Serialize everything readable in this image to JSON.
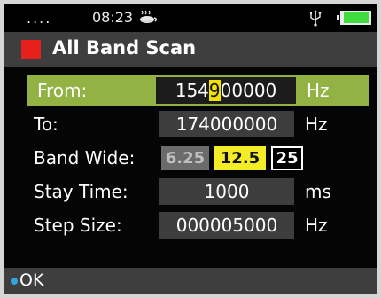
{
  "status_bar": {
    "dots": "....",
    "time": "08:23",
    "icons": [
      "coffee-cup-icon",
      "usb-icon",
      "battery-icon"
    ],
    "battery_color": "#3fdc3f"
  },
  "title_bar": {
    "title": "All Band Scan",
    "marker_color": "#e8201c"
  },
  "settings": {
    "from": {
      "label": "From:",
      "value_before_cursor": "154",
      "value_cursor": "9",
      "value_after_cursor": "00000",
      "unit": "Hz",
      "highlight_color": "#93b244"
    },
    "to": {
      "label": "To:",
      "value": "174000000",
      "unit": "Hz"
    },
    "band_wide": {
      "label": "Band Wide:",
      "options": [
        "6.25",
        "12.5",
        "25"
      ],
      "selected": "12.5"
    },
    "stay_time": {
      "label": "Stay Time:",
      "value": "1000",
      "unit": "ms"
    },
    "step_size": {
      "label": "Step Size:",
      "value": "000005000",
      "unit": "Hz"
    }
  },
  "bottom_bar": {
    "ok_label": "OK",
    "ok_dot_color": "#2fa8e0"
  }
}
